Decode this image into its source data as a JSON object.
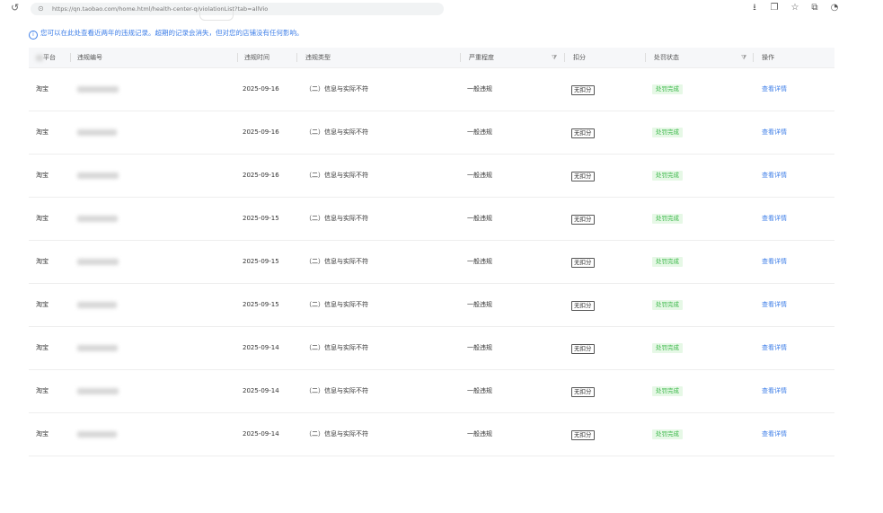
{
  "browser": {
    "url": "https://qn.taobao.com/home.html/health-center-q/violationList?tab=allVio"
  },
  "notice": "您可以在此处查看近两年的违规记录。超期的记录会消失，但对您的店铺没有任何影响。",
  "table": {
    "columns": {
      "platform": "平台",
      "violation_no": "违规编号",
      "time": "违规时间",
      "type": "违规类型",
      "severity": "严重程度",
      "score": "扣分",
      "status": "处罚状态",
      "action": "操作"
    },
    "rows": [
      {
        "platform": "淘宝",
        "date": "2025-09-16",
        "type": "（二）信息与实际不符",
        "severity": "一般违规",
        "score": "无扣分",
        "status": "处罚完成",
        "action": "查看详情"
      },
      {
        "platform": "淘宝",
        "date": "2025-09-16",
        "type": "（二）信息与实际不符",
        "severity": "一般违规",
        "score": "无扣分",
        "status": "处罚完成",
        "action": "查看详情"
      },
      {
        "platform": "淘宝",
        "date": "2025-09-16",
        "type": "（二）信息与实际不符",
        "severity": "一般违规",
        "score": "无扣分",
        "status": "处罚完成",
        "action": "查看详情"
      },
      {
        "platform": "淘宝",
        "date": "2025-09-15",
        "type": "（二）信息与实际不符",
        "severity": "一般违规",
        "score": "无扣分",
        "status": "处罚完成",
        "action": "查看详情"
      },
      {
        "platform": "淘宝",
        "date": "2025-09-15",
        "type": "（二）信息与实际不符",
        "severity": "一般违规",
        "score": "无扣分",
        "status": "处罚完成",
        "action": "查看详情"
      },
      {
        "platform": "淘宝",
        "date": "2025-09-15",
        "type": "（二）信息与实际不符",
        "severity": "一般违规",
        "score": "无扣分",
        "status": "处罚完成",
        "action": "查看详情"
      },
      {
        "platform": "淘宝",
        "date": "2025-09-14",
        "type": "（二）信息与实际不符",
        "severity": "一般违规",
        "score": "无扣分",
        "status": "处罚完成",
        "action": "查看详情"
      },
      {
        "platform": "淘宝",
        "date": "2025-09-14",
        "type": "（二）信息与实际不符",
        "severity": "一般违规",
        "score": "无扣分",
        "status": "处罚完成",
        "action": "查看详情"
      },
      {
        "platform": "淘宝",
        "date": "2025-09-14",
        "type": "（二）信息与实际不符",
        "severity": "一般违规",
        "score": "无扣分",
        "status": "处罚完成",
        "action": "查看详情"
      }
    ]
  },
  "icons": {
    "history": "history-icon",
    "lock": "lock-icon",
    "download": "download-icon",
    "copy": "copy-icon",
    "star": "star-icon",
    "tab": "tab-icon",
    "filter": "filter-icon",
    "info": "info-icon"
  },
  "colors": {
    "link": "#3f7fe8",
    "status_bg": "#e6f8e6",
    "status_text": "#3cb84a",
    "header_bg": "#f6f7f9"
  }
}
